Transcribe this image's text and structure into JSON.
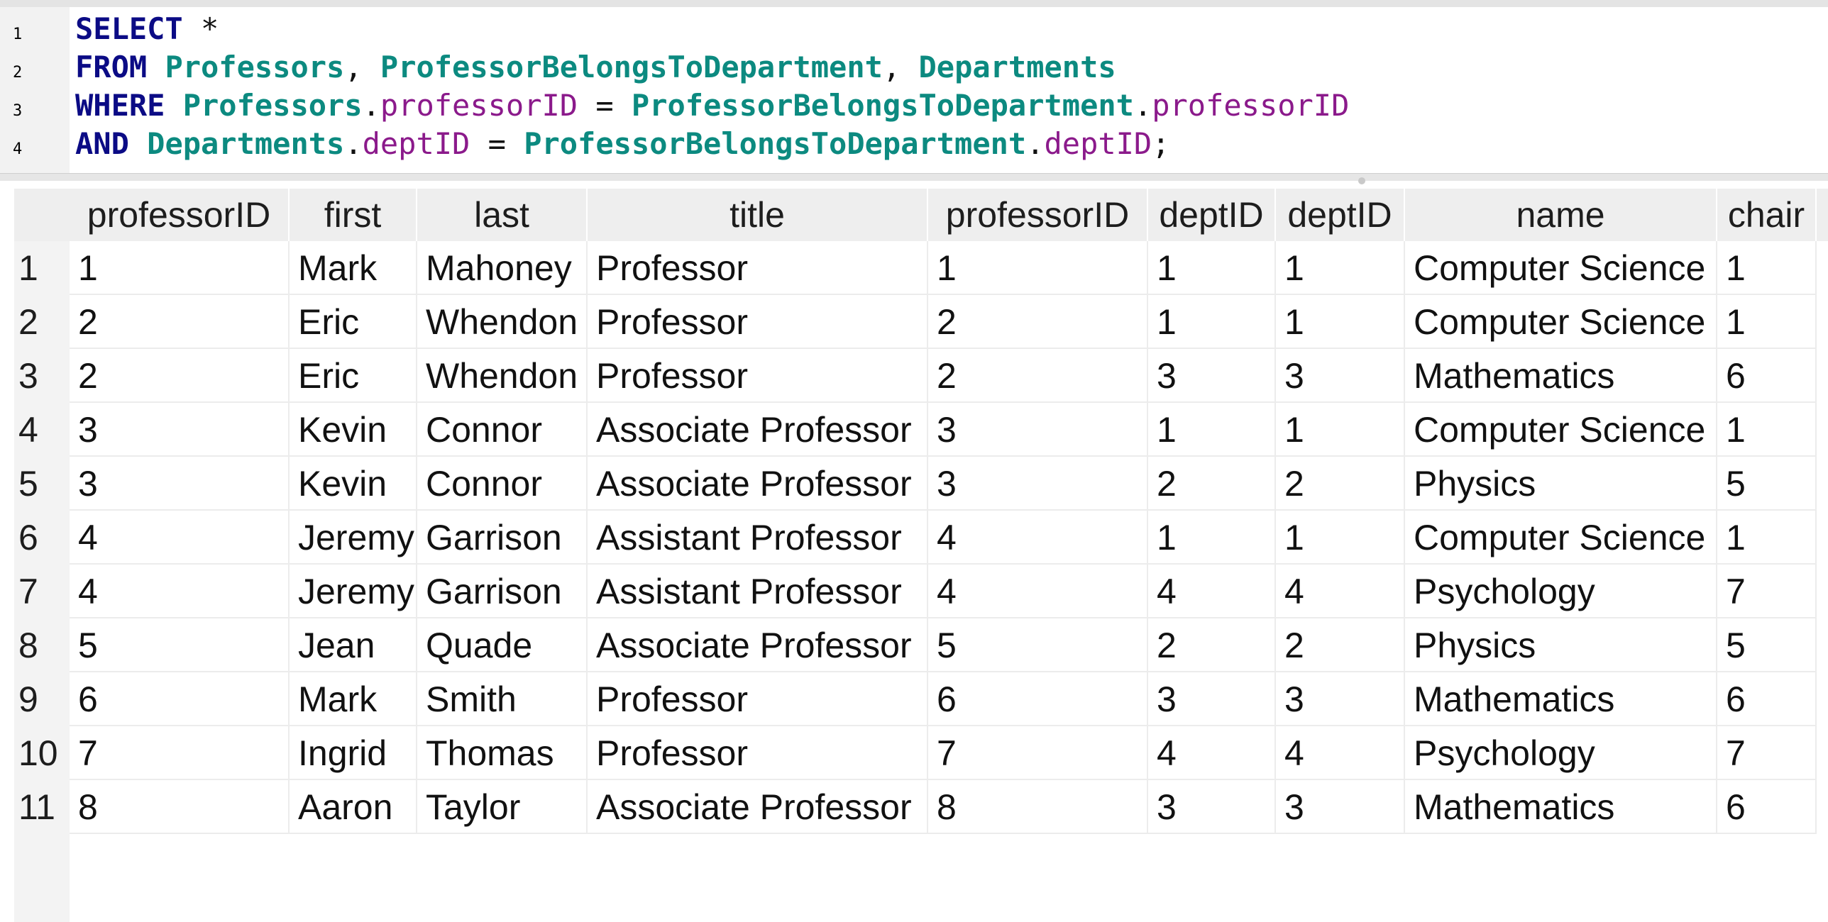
{
  "editor": {
    "line_numbers": [
      "1",
      "2",
      "3",
      "4"
    ],
    "lines": [
      [
        {
          "t": "SELECT",
          "c": "kw"
        },
        {
          "t": " *",
          "c": "op"
        }
      ],
      [
        {
          "t": "FROM",
          "c": "kw"
        },
        {
          "t": " ",
          "c": "op"
        },
        {
          "t": "Professors",
          "c": "tbl"
        },
        {
          "t": ", ",
          "c": "op"
        },
        {
          "t": "ProfessorBelongsToDepartment",
          "c": "tbl"
        },
        {
          "t": ", ",
          "c": "op"
        },
        {
          "t": "Departments",
          "c": "tbl"
        }
      ],
      [
        {
          "t": "WHERE",
          "c": "kw"
        },
        {
          "t": " ",
          "c": "op"
        },
        {
          "t": "Professors",
          "c": "tbl"
        },
        {
          "t": ".",
          "c": "op"
        },
        {
          "t": "professorID",
          "c": "col"
        },
        {
          "t": " = ",
          "c": "op"
        },
        {
          "t": "ProfessorBelongsToDepartment",
          "c": "tbl"
        },
        {
          "t": ".",
          "c": "op"
        },
        {
          "t": "professorID",
          "c": "col"
        }
      ],
      [
        {
          "t": "AND",
          "c": "kw"
        },
        {
          "t": " ",
          "c": "op"
        },
        {
          "t": "Departments",
          "c": "tbl"
        },
        {
          "t": ".",
          "c": "op"
        },
        {
          "t": "deptID",
          "c": "col"
        },
        {
          "t": " = ",
          "c": "op"
        },
        {
          "t": "ProfessorBelongsToDepartment",
          "c": "tbl"
        },
        {
          "t": ".",
          "c": "op"
        },
        {
          "t": "deptID",
          "c": "col"
        },
        {
          "t": ";",
          "c": "op"
        }
      ]
    ],
    "colors": {
      "keyword": "#0b0b85",
      "table": "#0c8a80",
      "column": "#8b1a8b"
    }
  },
  "results": {
    "columns": [
      "professorID",
      "first",
      "last",
      "title",
      "professorID",
      "deptID",
      "deptID",
      "name",
      "chair"
    ],
    "row_numbers": [
      "1",
      "2",
      "3",
      "4",
      "5",
      "6",
      "7",
      "8",
      "9",
      "10",
      "11"
    ],
    "rows": [
      [
        "1",
        "Mark",
        "Mahoney",
        "Professor",
        "1",
        "1",
        "1",
        "Computer Science",
        "1"
      ],
      [
        "2",
        "Eric",
        "Whendon",
        "Professor",
        "2",
        "1",
        "1",
        "Computer Science",
        "1"
      ],
      [
        "2",
        "Eric",
        "Whendon",
        "Professor",
        "2",
        "3",
        "3",
        "Mathematics",
        "6"
      ],
      [
        "3",
        "Kevin",
        "Connor",
        "Associate Professor",
        "3",
        "1",
        "1",
        "Computer Science",
        "1"
      ],
      [
        "3",
        "Kevin",
        "Connor",
        "Associate Professor",
        "3",
        "2",
        "2",
        "Physics",
        "5"
      ],
      [
        "4",
        "Jeremy",
        "Garrison",
        "Assistant Professor",
        "4",
        "1",
        "1",
        "Computer Science",
        "1"
      ],
      [
        "4",
        "Jeremy",
        "Garrison",
        "Assistant Professor",
        "4",
        "4",
        "4",
        "Psychology",
        "7"
      ],
      [
        "5",
        "Jean",
        "Quade",
        "Associate Professor",
        "5",
        "2",
        "2",
        "Physics",
        "5"
      ],
      [
        "6",
        "Mark",
        "Smith",
        "Professor",
        "6",
        "3",
        "3",
        "Mathematics",
        "6"
      ],
      [
        "7",
        "Ingrid",
        "Thomas",
        "Professor",
        "7",
        "4",
        "4",
        "Psychology",
        "7"
      ],
      [
        "8",
        "Aaron",
        "Taylor",
        "Associate Professor",
        "8",
        "3",
        "3",
        "Mathematics",
        "6"
      ]
    ]
  }
}
